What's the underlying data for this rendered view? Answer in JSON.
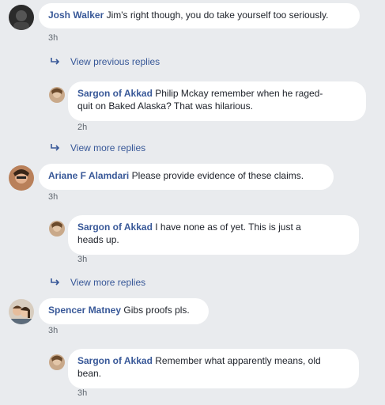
{
  "comments": [
    {
      "author": "Josh Walker",
      "text": "Jim's right though, you do take yourself too seriously.",
      "time": "3h",
      "view_previous": "View previous replies",
      "reply": {
        "author": "Sargon of Akkad",
        "text_line1": "Philip Mckay remember when he raged-",
        "text_line2": "quit on Baked Alaska? That was hilarious.",
        "time": "2h"
      },
      "view_more": "View more replies"
    },
    {
      "author": "Ariane F Alamdari",
      "text": "Please provide evidence of these claims.",
      "time": "3h",
      "reply": {
        "author": "Sargon of Akkad",
        "text_line1": "I have none as of yet. This is just a",
        "text_line2": "heads up.",
        "time": "3h"
      },
      "view_more": "View more replies"
    },
    {
      "author": "Spencer Matney",
      "text": "Gibs proofs pls.",
      "time": "3h",
      "reply": {
        "author": "Sargon of Akkad",
        "text_line1": "Remember what apparently means, old",
        "text_line2": "bean.",
        "time": "3h"
      }
    }
  ],
  "icons": {
    "reply_arrow": "reply-arrow-icon"
  }
}
